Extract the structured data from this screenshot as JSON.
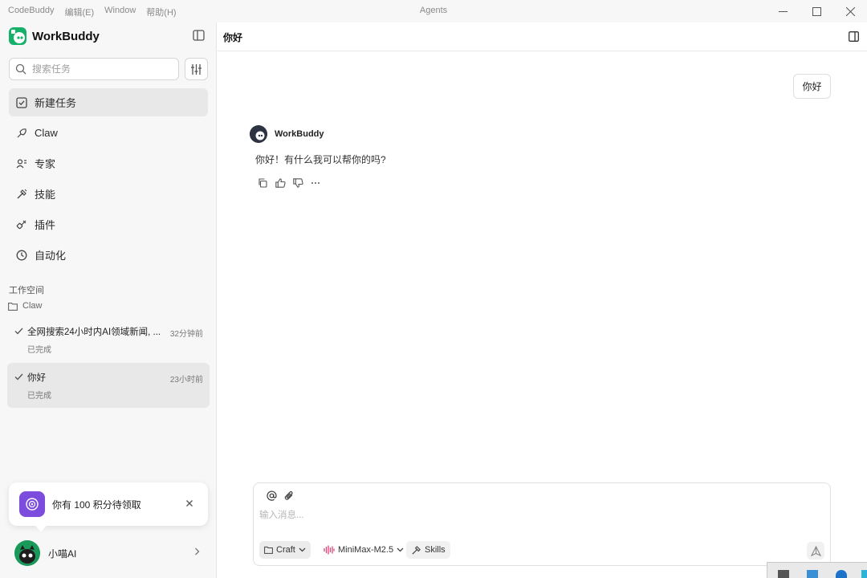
{
  "titlebar": {
    "menus": [
      "CodeBuddy",
      "编辑(E)",
      "Window",
      "帮助(H)"
    ],
    "title": "Agents"
  },
  "sidebar": {
    "brand": "WorkBuddy",
    "search_placeholder": "搜索任务",
    "nav": [
      {
        "label": "新建任务",
        "icon": "new-task-icon",
        "active": true
      },
      {
        "label": "Claw",
        "icon": "claw-icon"
      },
      {
        "label": "专家",
        "icon": "expert-icon"
      },
      {
        "label": "技能",
        "icon": "skills-icon"
      },
      {
        "label": "插件",
        "icon": "plugin-icon"
      },
      {
        "label": "自动化",
        "icon": "clock-icon"
      }
    ],
    "workspace_label": "工作空间",
    "workspace_folder": "Claw",
    "tasks": [
      {
        "title": "全网搜索24小时内AI领域新闻, ...",
        "time": "32分钟前",
        "status": "已完成"
      },
      {
        "title": "你好",
        "time": "23小时前",
        "status": "已完成",
        "active": true
      }
    ],
    "points_notice": "你有 100 积分待领取",
    "user_name": "小喵AI"
  },
  "main": {
    "title": "你好",
    "user_message": "你好",
    "bot_name": "WorkBuddy",
    "bot_message": "你好！有什么我可以帮你的吗?",
    "composer": {
      "placeholder": "输入消息...",
      "mode": "Craft",
      "model": "MiniMax-M2.5",
      "skills": "Skills"
    }
  },
  "colors": {
    "brand_green": "#15b06a",
    "points_purple": "#7c4ddc",
    "model_pink": "#e0457b"
  }
}
